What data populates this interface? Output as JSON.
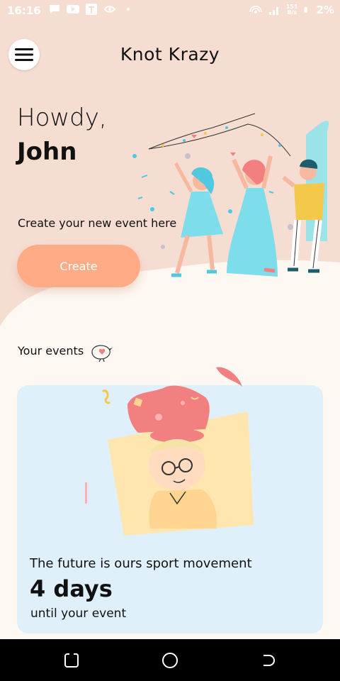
{
  "status_bar": {
    "time": "16:16",
    "network_speed": "151",
    "network_speed_unit": "B/s",
    "battery": "2%",
    "icons_left": [
      "chat-icon",
      "youtube-icon",
      "t-app-icon",
      "bird-app-icon",
      "dot-icon"
    ],
    "icons_right": [
      "hotspot-icon",
      "signal-icon",
      "battery-icon"
    ]
  },
  "header": {
    "title": "Knot Krazy",
    "menu_icon": "hamburger-icon"
  },
  "hero": {
    "greeting": "Howdy,",
    "user_name": "John",
    "create_prompt": "Create your new event here",
    "create_button_label": "Create",
    "illustration": "party-illustration"
  },
  "events": {
    "heading": "Your events",
    "heading_icon": "bird-icon",
    "cards": [
      {
        "title": "The future is ours sport movement",
        "days_left": "4 days",
        "subtitle": "until your event",
        "illustration": "person-with-hat-illustration"
      }
    ]
  },
  "nav_bar": {
    "buttons": [
      "recents-button",
      "home-button",
      "back-button"
    ]
  },
  "colors": {
    "hero_background": "#F6DDD2",
    "page_background": "#FDF8F2",
    "accent": "#FFAB85",
    "card_background": "#DFF0FB"
  }
}
